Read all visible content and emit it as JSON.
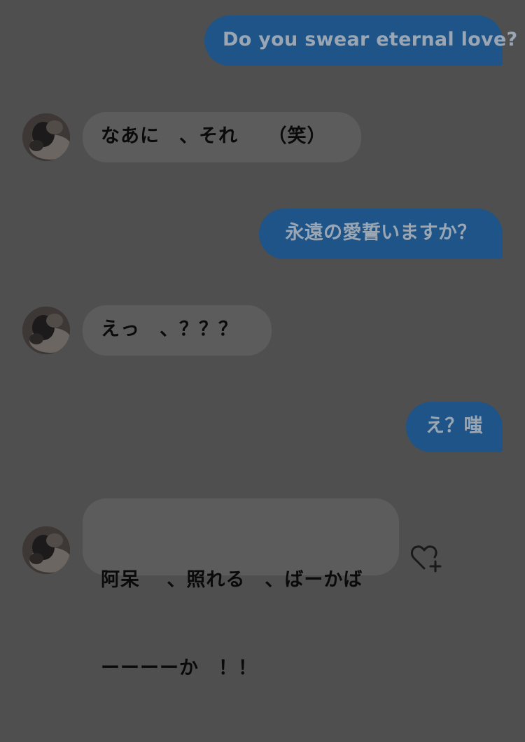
{
  "messages": [
    {
      "from": "me",
      "text": "Do you swear eternal love?"
    },
    {
      "from": "them",
      "text": "なあに　、それ　　（笑）"
    },
    {
      "from": "me",
      "text": "永遠の愛誓いますか？"
    },
    {
      "from": "them",
      "text": "えっ　、？？？"
    },
    {
      "from": "me",
      "text": "え？嗤"
    },
    {
      "from": "them",
      "lines": [
        "阿呆　 、照れる　、ばーかば",
        "ーーーーか　！！"
      ]
    }
  ],
  "colors": {
    "sent_bubble": "#1e5487",
    "received_bubble": "#5c5c5c",
    "background": "#4f4f4f"
  },
  "icons": {
    "reaction": "heart-plus-icon",
    "avatar": "avatar"
  }
}
